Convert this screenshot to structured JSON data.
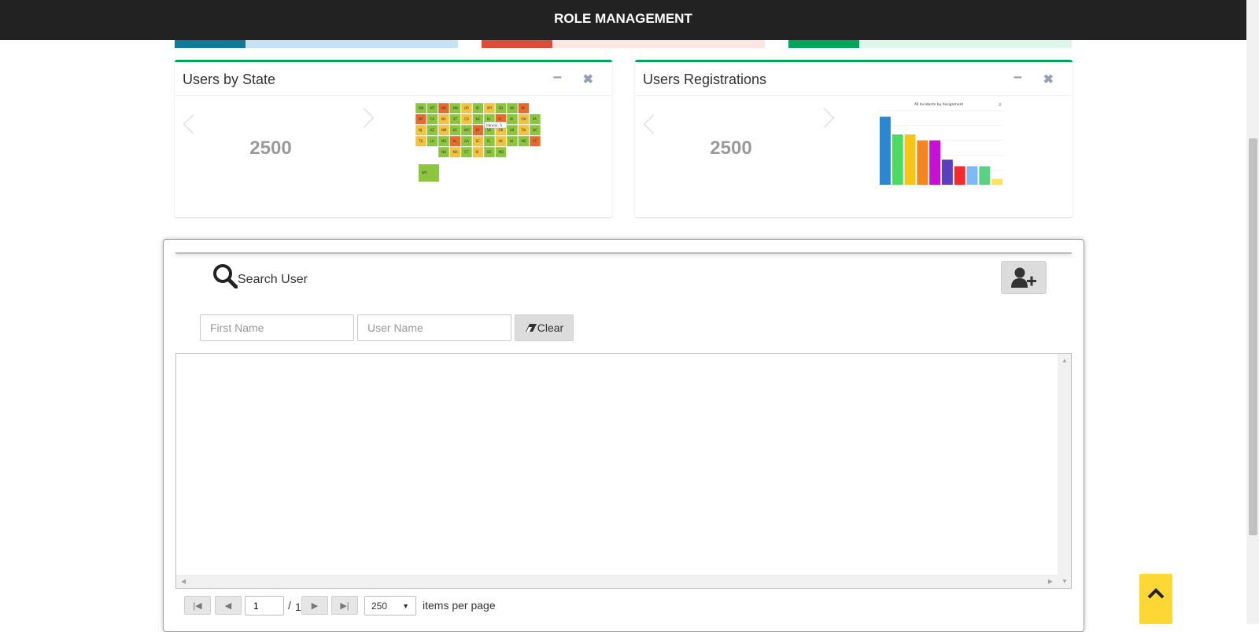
{
  "header": {
    "title": "ROLE MANAGEMENT"
  },
  "progress_bars": [
    {
      "fill_percent": 25,
      "track_color": "#c6e2f5",
      "fill_color": "#0f7a9a"
    },
    {
      "fill_percent": 25,
      "track_color": "#fbe6e2",
      "fill_color": "#dd4b39"
    },
    {
      "fill_percent": 25,
      "track_color": "#dcf6ea",
      "fill_color": "#00a65a"
    }
  ],
  "panels": {
    "state": {
      "title": "Users by State",
      "value": "2500"
    },
    "registrations": {
      "title": "Users Registrations",
      "value": "2500"
    }
  },
  "map_labels": [
    "WA",
    "MT",
    "ND",
    "MN",
    "OR",
    "ID",
    "WY",
    "SD",
    "WI",
    "MI",
    "NY",
    "CA",
    "NV",
    "UT",
    "CO",
    "NE",
    "IA",
    "IL",
    "IN",
    "OH",
    "PA",
    "NJ",
    "AZ",
    "NM",
    "KS",
    "MO",
    "KY",
    "VA",
    "OK",
    "AR",
    "TN",
    "NC",
    "TX",
    "LA",
    "MS",
    "AL",
    "GA",
    "SC",
    "FL",
    "AK",
    "HI",
    "ME",
    "VT",
    "NH",
    "MA",
    "CT",
    "RI",
    "DE",
    "MD",
    "WV"
  ],
  "map_tooltip": "Illinois: 5",
  "chart_data": {
    "type": "bar",
    "title": "All Incidents by Assignment",
    "values": [
      9.2,
      6.8,
      6.8,
      6.0,
      6.0,
      3.4,
      2.5,
      2.5,
      2.5,
      0.8
    ],
    "colors": [
      "#2b87d1",
      "#4cd964",
      "#f5c518",
      "#f5851f",
      "#c710d6",
      "#5b3fbf",
      "#f22b2b",
      "#7eb8f5",
      "#5ad183",
      "#ffe066"
    ],
    "ylim": [
      0,
      10
    ]
  },
  "search": {
    "title": "Search User",
    "first_name_placeholder": "First Name",
    "user_name_placeholder": "User Name",
    "clear_label": "Clear"
  },
  "pager": {
    "page": "1",
    "separator": "/",
    "total": "1",
    "per_page": "250",
    "per_page_label": "items per page"
  },
  "colors": {
    "accent_green": "#00a65a",
    "header_bg": "#222222",
    "back_to_top": "#fdd835"
  }
}
